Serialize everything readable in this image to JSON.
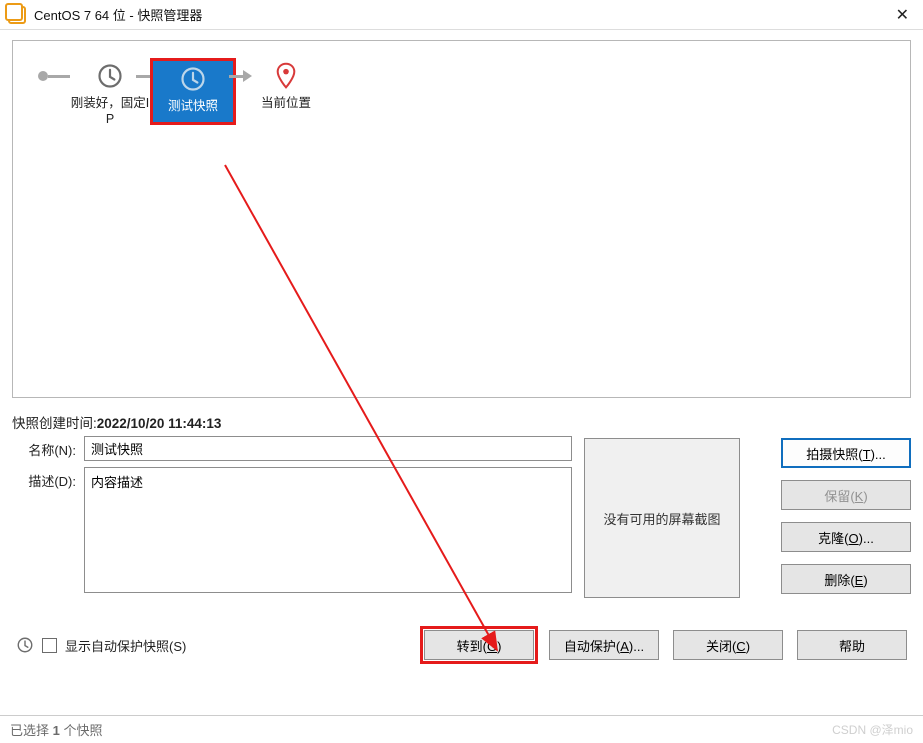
{
  "window": {
    "title": "CentOS 7 64 位 - 快照管理器"
  },
  "tree": {
    "node1_label": "刚装好，固定IP",
    "node2_label": "测试快照",
    "node3_label": "当前位置"
  },
  "detail": {
    "created_label": "快照创建时间:",
    "created_value": "2022/10/20 11:44:13",
    "name_label": "名称(N):",
    "name_value": "测试快照",
    "desc_label": "描述(D):",
    "desc_value": "内容描述",
    "thumb_text": "没有可用的屏幕截图"
  },
  "actions": {
    "take": "拍摄快照(T)...",
    "keep": "保留(K)",
    "clone": "克隆(O)...",
    "delete": "删除(E)"
  },
  "bottom": {
    "show_autoprotect": "显示自动保护快照(S)",
    "goto": "转到(G)",
    "autoprotect": "自动保护(A)...",
    "close": "关闭(C)",
    "help": "帮助"
  },
  "status": {
    "selected_prefix": "已选择 ",
    "selected_count": "1",
    "selected_suffix": " 个快照",
    "watermark": "CSDN @泽mio"
  }
}
